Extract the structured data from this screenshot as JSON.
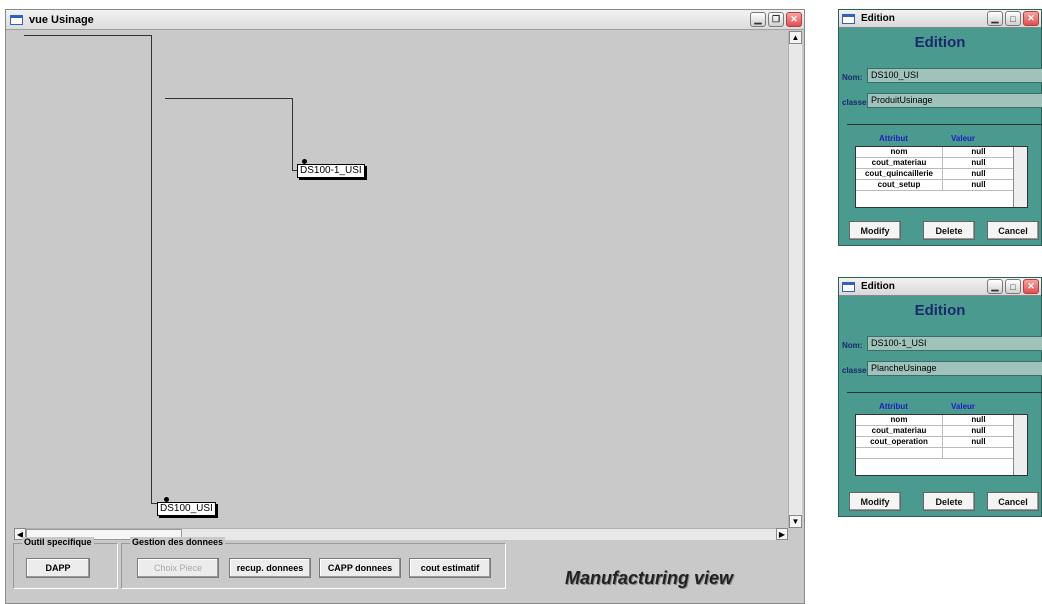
{
  "main_window": {
    "title": "vue Usinage",
    "window_buttons": [
      "minimize",
      "restore",
      "close"
    ]
  },
  "canvas": {
    "nodes": [
      {
        "label": "DS100-1_USI"
      },
      {
        "label": "DS100_USI"
      }
    ]
  },
  "bottom_panel": {
    "outil_group": {
      "label": "Outil specifique",
      "buttons": [
        {
          "label": "DAPP",
          "enabled": true
        }
      ]
    },
    "gestion_group": {
      "label": "Gestion des donnees",
      "buttons": [
        {
          "label": "Choix Piece",
          "enabled": false
        },
        {
          "label": "recup. donnees",
          "enabled": true
        },
        {
          "label": "CAPP donnees",
          "enabled": true
        },
        {
          "label": "cout estimatif",
          "enabled": true
        }
      ]
    }
  },
  "caption": "Manufacturing view",
  "edition_windows": [
    {
      "title": "Edition",
      "heading": "Edition",
      "nom_label": "Nom:",
      "nom_value": "DS100_USI",
      "classe_label": "classe:",
      "classe_value": "ProduitUsinage",
      "tab_attribut": "Attribut",
      "tab_valeur": "Valeur",
      "rows": [
        {
          "attr": "nom",
          "val": "null"
        },
        {
          "attr": "cout_materiau",
          "val": "null"
        },
        {
          "attr": "cout_quincaillerie",
          "val": "null"
        },
        {
          "attr": "cout_setup",
          "val": "null"
        }
      ],
      "buttons": {
        "modify": "Modify",
        "delete": "Delete",
        "cancel": "Cancel"
      }
    },
    {
      "title": "Edition",
      "heading": "Edition",
      "nom_label": "Nom:",
      "nom_value": "DS100-1_USI",
      "classe_label": "classe:",
      "classe_value": "PlancheUsinage",
      "tab_attribut": "Attribut",
      "tab_valeur": "Valeur",
      "rows": [
        {
          "attr": "nom",
          "val": "null"
        },
        {
          "attr": "cout_materiau",
          "val": "null"
        },
        {
          "attr": "cout_operation",
          "val": "null"
        },
        {
          "attr": "",
          "val": ""
        }
      ],
      "buttons": {
        "modify": "Modify",
        "delete": "Delete",
        "cancel": "Cancel"
      }
    }
  ]
}
